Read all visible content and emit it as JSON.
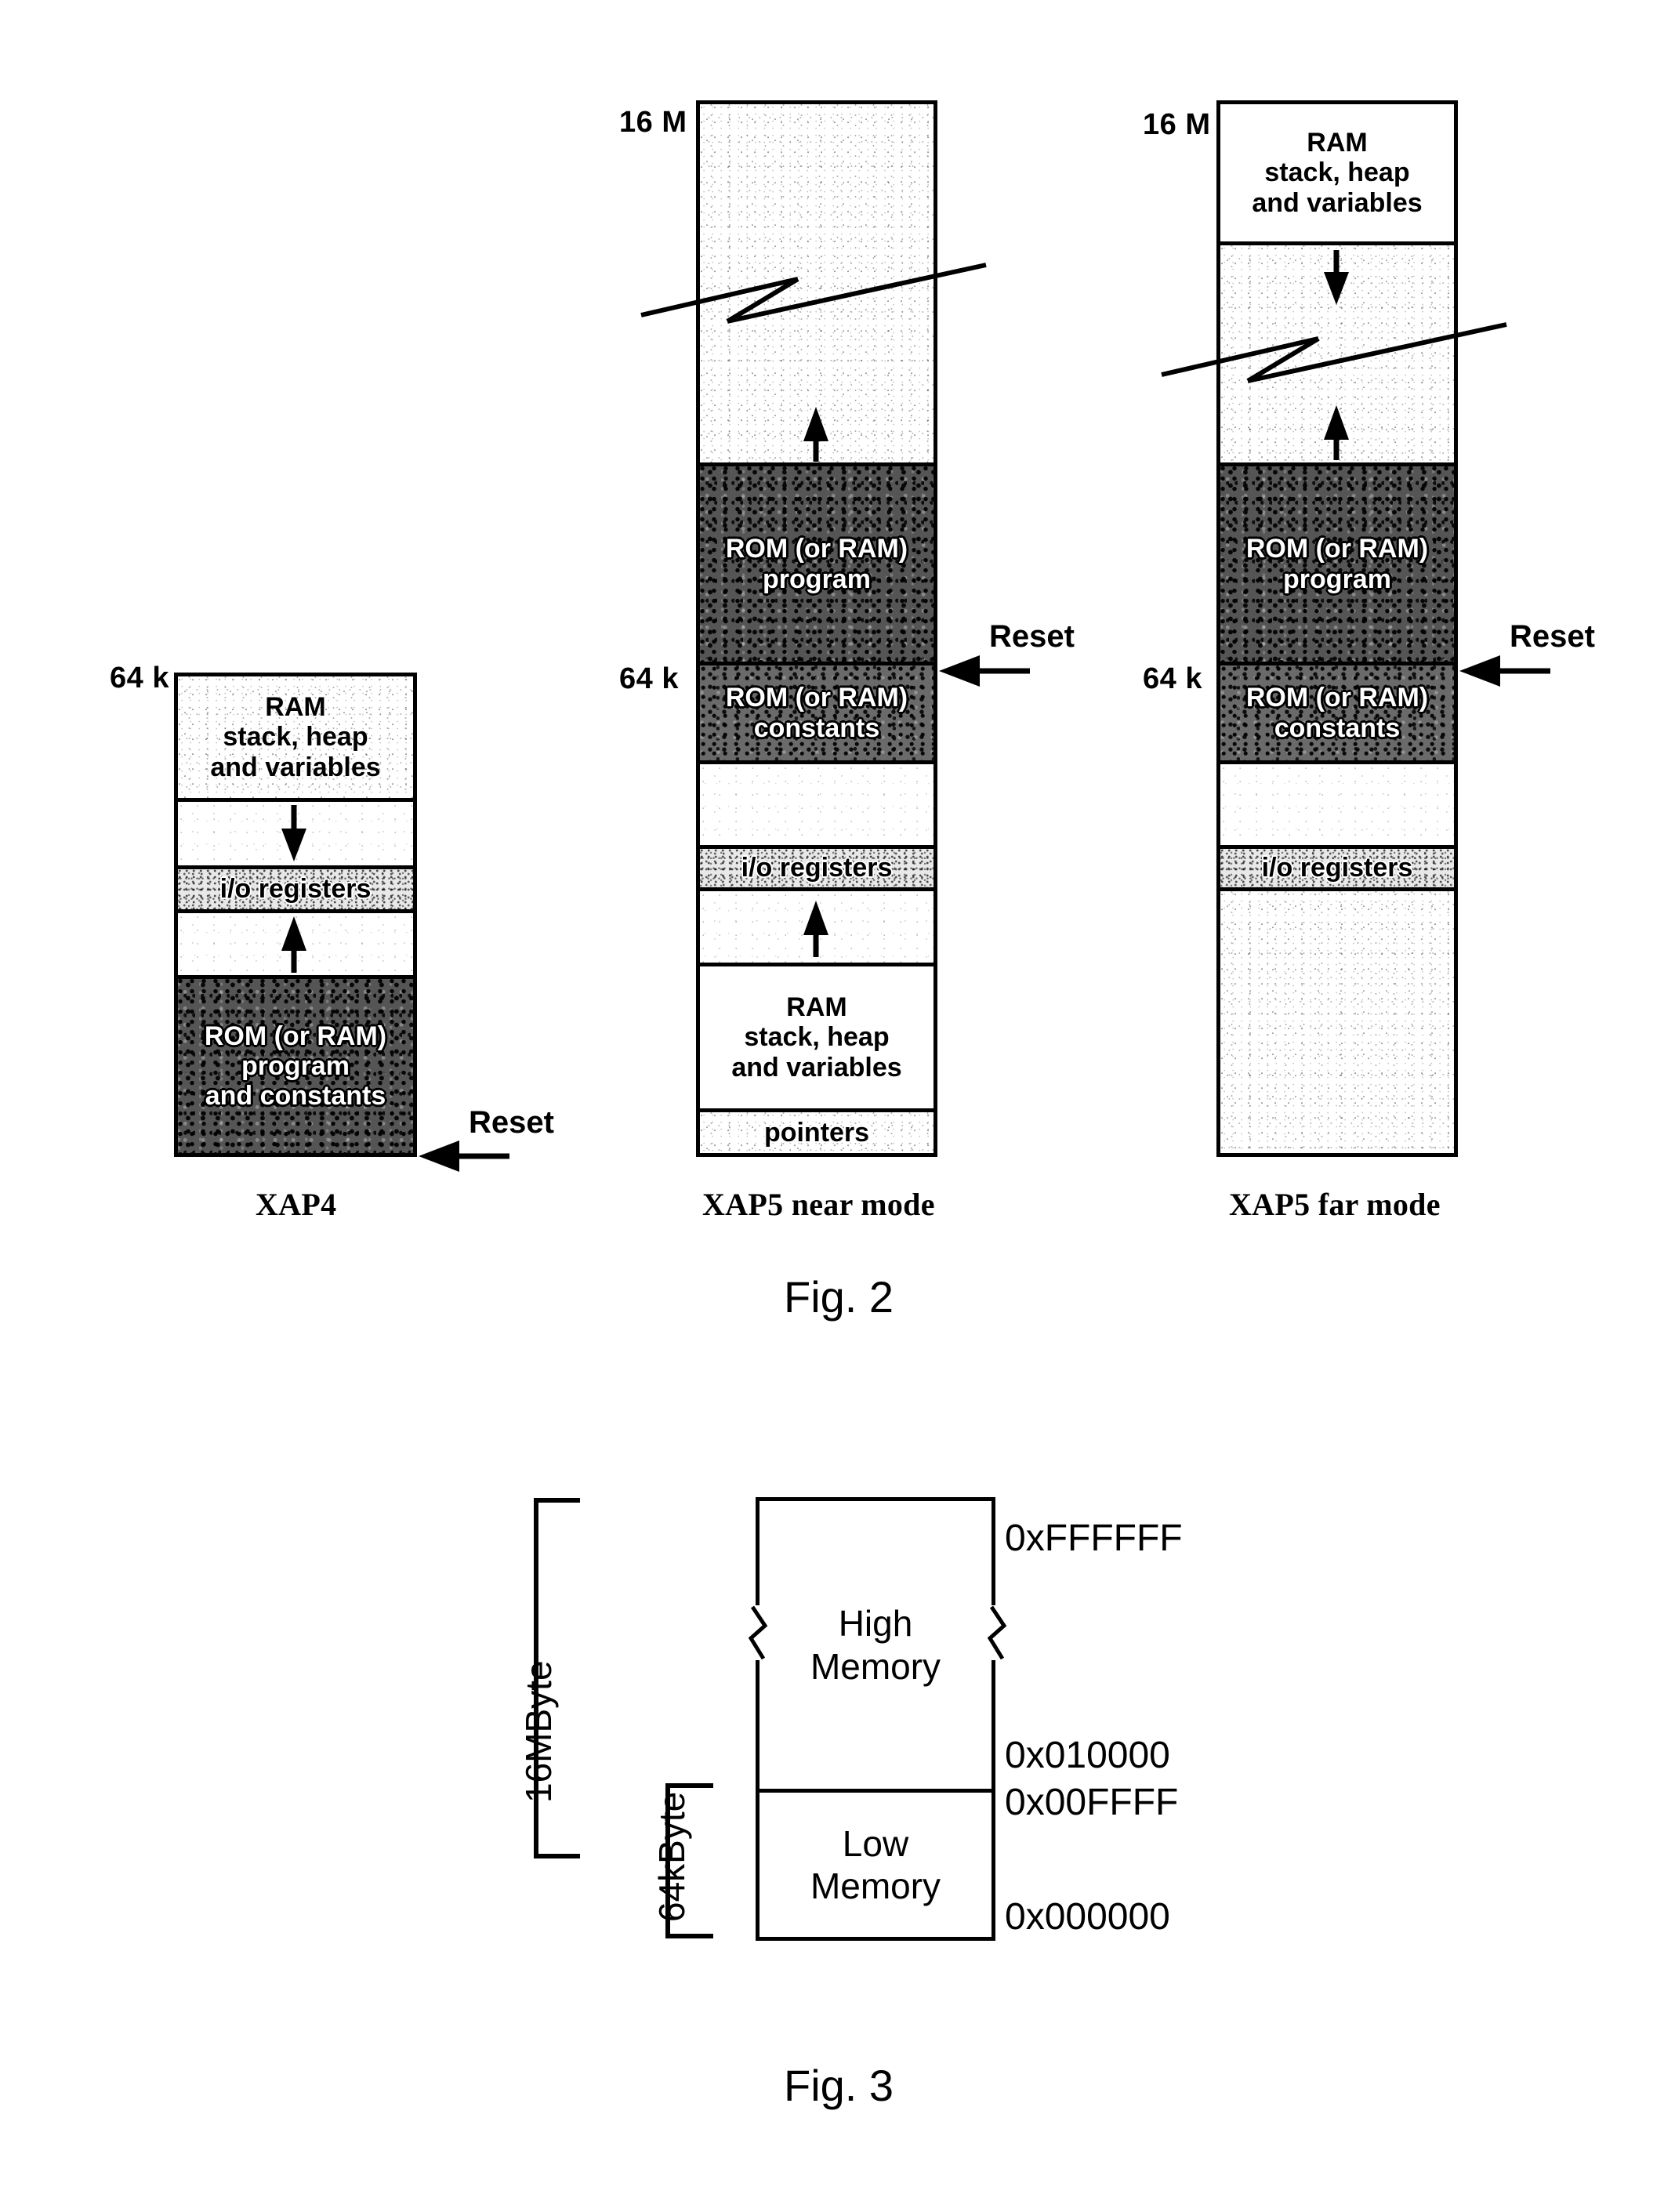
{
  "figure2": {
    "fig_label": "Fig. 2",
    "columns": [
      {
        "caption": "XAP4",
        "top_label": "64 k",
        "reset_label": "Reset",
        "blocks": [
          {
            "label": "RAM\nstack, heap\nand variables",
            "fill": "light"
          },
          {
            "label": "",
            "fill": "vlight",
            "arrow": "down"
          },
          {
            "label": "i/o registers",
            "fill": "mid"
          },
          {
            "label": "",
            "fill": "vlight",
            "arrow": "up"
          },
          {
            "label": "ROM (or RAM)\nprogram\nand constants",
            "fill": "dark"
          }
        ]
      },
      {
        "caption": "XAP5 near mode",
        "top_label": "16 M",
        "mid_label": "64 k",
        "reset_label": "Reset",
        "blocks": [
          {
            "label": "",
            "fill": "light",
            "arrow": "up",
            "break": true
          },
          {
            "label": "ROM (or RAM)\nprogram",
            "fill": "dark"
          },
          {
            "label": "ROM (or RAM)\nconstants",
            "fill": "dark2"
          },
          {
            "label": "",
            "fill": "vlight"
          },
          {
            "label": "i/o registers",
            "fill": "mid"
          },
          {
            "label": "",
            "fill": "vlight",
            "arrow": "up"
          },
          {
            "label": "RAM\nstack, heap\nand variables",
            "fill": "white"
          },
          {
            "label": "pointers",
            "fill": "light"
          }
        ]
      },
      {
        "caption": "XAP5 far mode",
        "top_label": "16 M",
        "mid_label": "64 k",
        "reset_label": "Reset",
        "blocks": [
          {
            "label": "RAM\nstack, heap\nand variables",
            "fill": "white"
          },
          {
            "label": "",
            "fill": "light",
            "arrow": "downup",
            "break": true
          },
          {
            "label": "ROM (or RAM)\nprogram",
            "fill": "dark"
          },
          {
            "label": "ROM (or RAM)\nconstants",
            "fill": "dark2"
          },
          {
            "label": "",
            "fill": "vlight"
          },
          {
            "label": "i/o registers",
            "fill": "mid"
          },
          {
            "label": "",
            "fill": "light"
          }
        ]
      }
    ]
  },
  "figure3": {
    "fig_label": "Fig. 3",
    "regions": [
      {
        "name": "High\nMemory"
      },
      {
        "name": "Low\nMemory"
      }
    ],
    "addresses": {
      "top": "0xFFFFFF",
      "high_low_upper": "0x010000",
      "high_low_lower": "0x00FFFF",
      "bottom": "0x000000"
    },
    "brackets": {
      "total": "16MByte",
      "low": "64kByte"
    }
  }
}
